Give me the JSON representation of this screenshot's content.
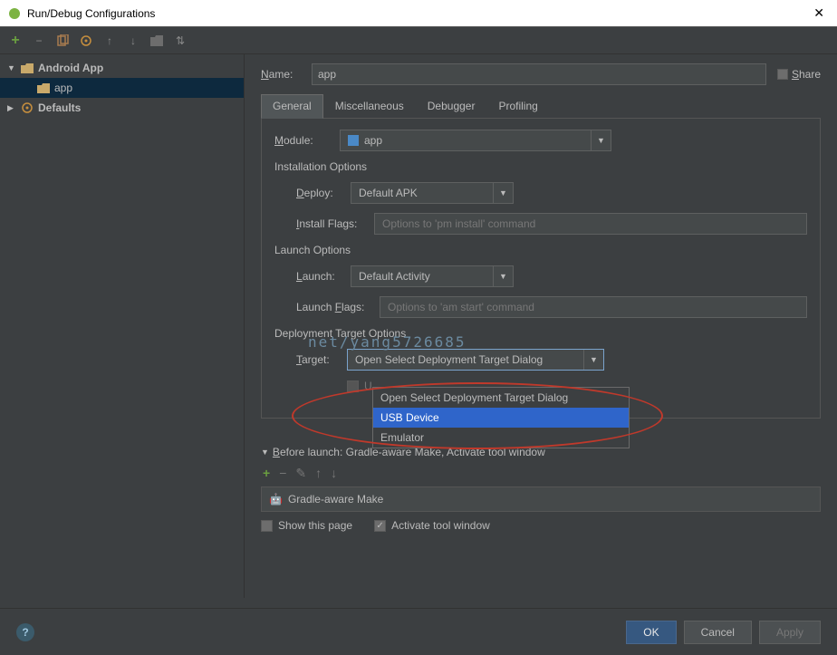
{
  "window": {
    "title": "Run/Debug Configurations"
  },
  "tree": {
    "root": "Android App",
    "selected": "app",
    "defaults": "Defaults"
  },
  "form": {
    "name_label": "Name:",
    "name_value": "app",
    "share_label": "Share"
  },
  "tabs": {
    "general": "General",
    "misc": "Miscellaneous",
    "debugger": "Debugger",
    "profiling": "Profiling"
  },
  "module": {
    "label": "Module:",
    "value": "app"
  },
  "install": {
    "section": "Installation Options",
    "deploy_label": "Deploy:",
    "deploy_value": "Default APK",
    "flags_label": "Install Flags:",
    "flags_placeholder": "Options to 'pm install' command"
  },
  "launch": {
    "section": "Launch Options",
    "launch_label": "Launch:",
    "launch_value": "Default Activity",
    "flags_label": "Launch Flags:",
    "flags_placeholder": "Options to 'am start' command"
  },
  "deploy_target": {
    "section": "Deployment Target Options",
    "target_label": "Target:",
    "target_value": "Open Select Deployment Target Dialog",
    "disabled_checkbox": "U",
    "options": {
      "o1": "Open Select Deployment Target Dialog",
      "o2": "USB Device",
      "o3": "Emulator"
    }
  },
  "before_launch": {
    "header": "Before launch: Gradle-aware Make, Activate tool window",
    "item": "Gradle-aware Make",
    "show_page": "Show this page",
    "activate": "Activate tool window"
  },
  "footer": {
    "ok": "OK",
    "cancel": "Cancel",
    "apply": "Apply"
  },
  "watermark": "net/yang5726685"
}
